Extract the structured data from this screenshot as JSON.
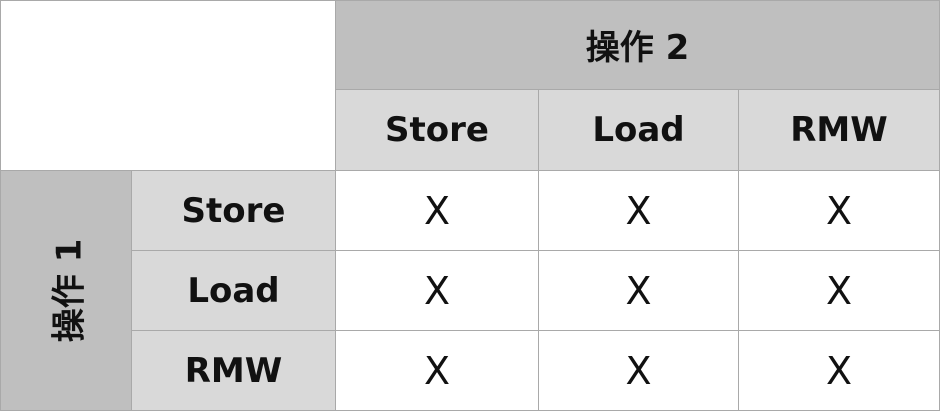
{
  "table": {
    "op2_label": "操作 2",
    "op1_label": "操作 1",
    "columns": [
      "Store",
      "Load",
      "RMW"
    ],
    "rows": [
      {
        "label": "Store",
        "cells": [
          "X",
          "X",
          "X"
        ]
      },
      {
        "label": "Load",
        "cells": [
          "X",
          "X",
          "X"
        ]
      },
      {
        "label": "RMW",
        "cells": [
          "X",
          "X",
          "X"
        ]
      }
    ]
  },
  "colors": {
    "header_dark": "#bfbfbf",
    "header_light": "#d9d9d9",
    "grid_line": "#a9a9a9",
    "body": "#ffffff"
  }
}
